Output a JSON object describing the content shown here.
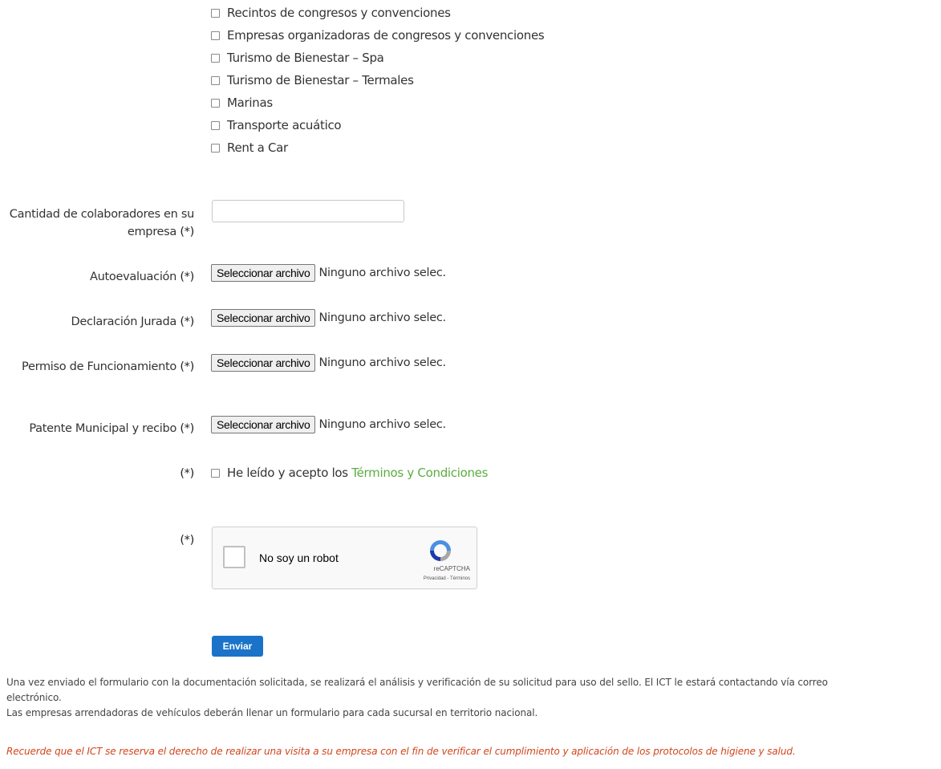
{
  "categories": [
    "Recintos de congresos y convenciones",
    "Empresas organizadoras de congresos y convenciones",
    "Turismo de Bienestar – Spa",
    "Turismo de Bienestar – Termales",
    "Marinas",
    "Transporte acuático",
    "Rent a Car"
  ],
  "form": {
    "required_mark": "(*)",
    "employees": {
      "label": "Cantidad de colaboradores en su empresa",
      "value": "",
      "placeholder": ""
    },
    "files": [
      {
        "label": "Autoevaluación",
        "button": "Seleccionar archivo",
        "status": "Ninguno archivo selec."
      },
      {
        "label": "Declaración Jurada",
        "button": "Seleccionar archivo",
        "status": "Ninguno archivo selec."
      },
      {
        "label": "Permiso de Funcionamiento",
        "button": "Seleccionar archivo",
        "status": "Ninguno archivo selec."
      },
      {
        "label": "Patente Municipal y recibo ",
        "button": "Seleccionar archivo",
        "status": "Ninguno archivo selec."
      }
    ],
    "terms": {
      "text": "He leído y acepto los ",
      "link": "Términos y Condiciones"
    },
    "captcha": {
      "label": "No soy un robot",
      "brand": "reCAPTCHA",
      "links": "Privacidad - Términos"
    },
    "submit": "Enviar"
  },
  "notes": {
    "line1": "Una vez enviado el formulario con la documentación solicitada, se realizará el análisis y verificación de su solicitud para uso del sello. El ICT le estará contactando vía correo",
    "line2": "electrónico.",
    "line3": "Las empresas arrendadoras de vehículos deberán llenar un formulario para cada sucursal en territorio nacional.",
    "warning": "Recuerde que el ICT se reserva el derecho de realizar una visita a su empresa con el fin de verificar el cumplimiento y aplicación de los protocolos de higiene y salud."
  },
  "colors": {
    "link": "#5aad3f",
    "button": "#1a73c8",
    "warning": "#d2451c"
  }
}
